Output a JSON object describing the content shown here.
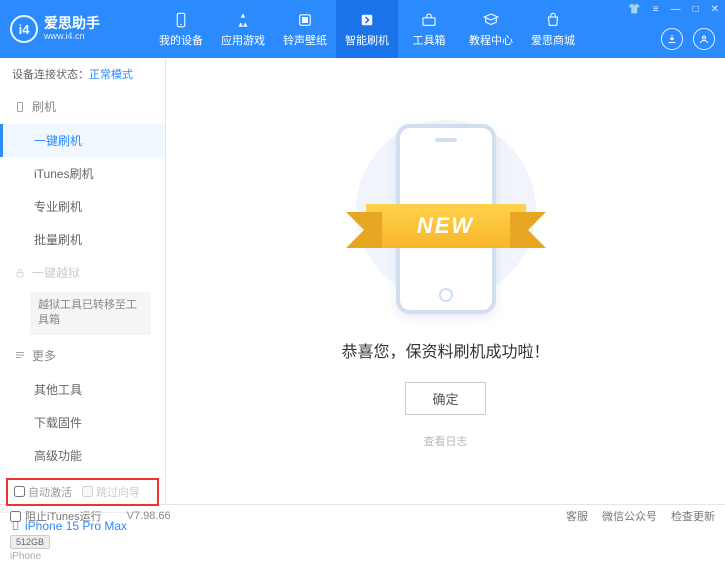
{
  "logo": {
    "title": "爱思助手",
    "sub": "www.i4.cn",
    "mark": "i4"
  },
  "topnav": {
    "items": [
      {
        "label": "我的设备"
      },
      {
        "label": "应用游戏"
      },
      {
        "label": "铃声壁纸"
      },
      {
        "label": "智能刷机"
      },
      {
        "label": "工具箱"
      },
      {
        "label": "教程中心"
      },
      {
        "label": "爱思商城"
      }
    ]
  },
  "status": {
    "label": "设备连接状态：",
    "value": "正常模式"
  },
  "sidebar": {
    "section_flash": "刷机",
    "items_flash": [
      {
        "label": "一键刷机"
      },
      {
        "label": "iTunes刷机"
      },
      {
        "label": "专业刷机"
      },
      {
        "label": "批量刷机"
      }
    ],
    "section_jailbreak": "一键越狱",
    "jailbreak_notice": "越狱工具已转移至工具箱",
    "section_more": "更多",
    "items_more": [
      {
        "label": "其他工具"
      },
      {
        "label": "下载固件"
      },
      {
        "label": "高级功能"
      }
    ]
  },
  "checkboxes": {
    "auto_activate": "自动激活",
    "skip_setup": "跳过向导"
  },
  "device": {
    "name": "iPhone 15 Pro Max",
    "storage": "512GB",
    "type": "iPhone"
  },
  "main": {
    "ribbon": "NEW",
    "success": "恭喜您，保资料刷机成功啦！",
    "ok": "确定",
    "log": "查看日志"
  },
  "footer": {
    "block_itunes": "阻止iTunes运行",
    "version": "V7.98.66",
    "links": [
      "客服",
      "微信公众号",
      "检查更新"
    ]
  }
}
